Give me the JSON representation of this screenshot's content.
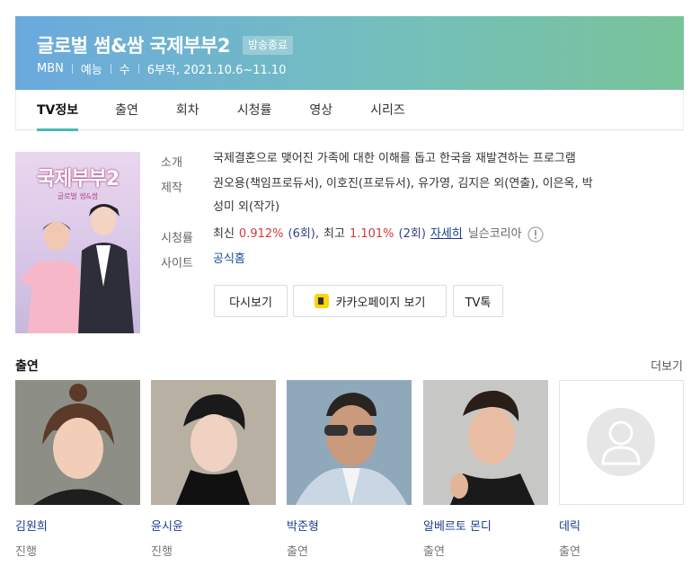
{
  "program": {
    "title": "글로벌 썸&쌈 국제부부2",
    "status_badge": "방송종료",
    "meta": [
      "MBN",
      "예능",
      "수",
      "6부작, 2021.10.6~11.10"
    ]
  },
  "tabs": [
    {
      "label": "TV정보",
      "active": true
    },
    {
      "label": "출연"
    },
    {
      "label": "회차"
    },
    {
      "label": "시청률"
    },
    {
      "label": "영상"
    },
    {
      "label": "시리즈"
    }
  ],
  "poster": {
    "title": "국제부부2",
    "subtitle": "글로벌 썸&쌈"
  },
  "info": {
    "intro_label": "소개",
    "intro": "국제결혼으로 맺어진 가족에 대한 이해를 돕고 한국을 재발견하는 프로그램",
    "production_label": "제작",
    "production_line1": "권오용(책임프로듀서), 이호진(프로듀서), 유가영, 김지은 외(연출), 이은옥, 박",
    "production_line2": "성미 외(작가)",
    "ratings_label": "시청률",
    "ratings_latest_prefix": "최신",
    "ratings_latest_value": "0.912%",
    "ratings_latest_ep": "(6회),",
    "ratings_best_prefix": "최고",
    "ratings_best_value": "1.101%",
    "ratings_best_ep": "(2회)",
    "ratings_detail_link": "자세히",
    "ratings_source": "닐슨코리아",
    "site_label": "사이트",
    "site_link": "공식홈"
  },
  "buttons": {
    "rewatch": "다시보기",
    "kakao": "카카오페이지 보기",
    "tvtalk": "TV톡"
  },
  "cast_section": {
    "title": "출연",
    "more": "더보기",
    "members": [
      {
        "name": "김원희",
        "role": "진행"
      },
      {
        "name": "윤시윤",
        "role": "진행"
      },
      {
        "name": "박준형",
        "role": "출연"
      },
      {
        "name": "알베르토 몬디",
        "role": "출연"
      },
      {
        "name": "데릭",
        "role": "출연"
      }
    ]
  },
  "colors": {
    "tab_accent": "#4abab5",
    "header_start": "#6aa9de",
    "header_end": "#79c39a",
    "rating_red": "#d23a3a"
  }
}
